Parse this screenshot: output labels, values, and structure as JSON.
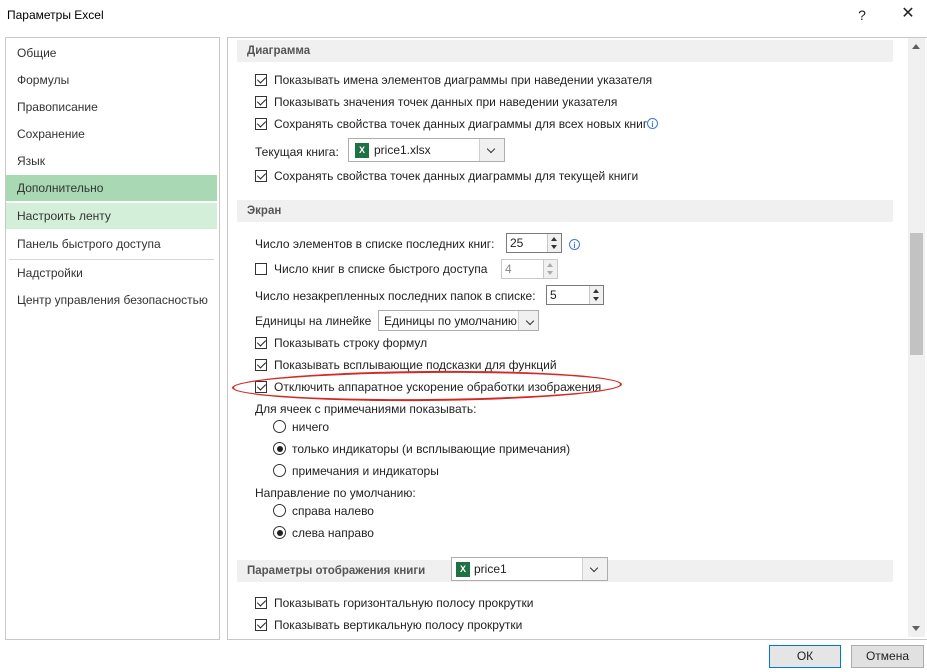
{
  "window": {
    "title": "Параметры Excel",
    "help_label": "?",
    "close_label": "✕"
  },
  "sidebar": {
    "items": [
      {
        "label": "Общие"
      },
      {
        "label": "Формулы"
      },
      {
        "label": "Правописание"
      },
      {
        "label": "Сохранение"
      },
      {
        "label": "Язык"
      },
      {
        "label": "Дополнительно"
      },
      {
        "label": "Настроить ленту"
      },
      {
        "label": "Панель быстрого доступа"
      },
      {
        "label": "Надстройки"
      },
      {
        "label": "Центр управления безопасностью"
      }
    ],
    "active_item": "Дополнительно"
  },
  "chart_section": {
    "header": "Диаграмма",
    "options": [
      {
        "label": "Показывать имена элементов диаграммы при наведении указателя",
        "checked": true
      },
      {
        "label": "Показывать значения точек данных при наведении указателя",
        "checked": true
      },
      {
        "label": "Сохранять свойства точек данных диаграммы для всех новых книг",
        "checked": true
      }
    ],
    "current_book_label": "Текущая книга:",
    "current_book_value": "price1.xlsx",
    "current_book_option": {
      "label": "Сохранять свойства точек данных диаграммы для текущей книги",
      "checked": true
    }
  },
  "screen_section": {
    "header": "Экран",
    "recent_count_label": "Число элементов в списке последних книг:",
    "recent_count_value": "25",
    "quick_access_label": "Число книг в списке быстрого доступа",
    "quick_access_checked": false,
    "quick_access_value": "4",
    "unpinned_folders_label": "Число незакрепленных последних папок в списке:",
    "unpinned_folders_value": "5",
    "ruler_units_label": "Единицы на линейке",
    "ruler_units_value": "Единицы по умолчанию",
    "show_formula_bar": {
      "label": "Показывать строку формул",
      "checked": true
    },
    "show_function_tips": {
      "label": "Показывать всплывающие подсказки для функций",
      "checked": true
    },
    "disable_hw_accel": {
      "label": "Отключить аппаратное ускорение обработки изображения",
      "checked": true
    },
    "comments_label": "Для ячеек с примечаниями показывать:",
    "comments_options": [
      {
        "label": "ничего",
        "checked": false
      },
      {
        "label": "только индикаторы (и всплывающие примечания)",
        "checked": true
      },
      {
        "label": "примечания и индикаторы",
        "checked": false
      }
    ],
    "direction_label": "Направление по умолчанию:",
    "direction_options": [
      {
        "label": "справа налево",
        "checked": false
      },
      {
        "label": "слева направо",
        "checked": true
      }
    ]
  },
  "book_display_section": {
    "header": "Параметры отображения книги",
    "book_value": "price1",
    "options": [
      {
        "label": "Показывать горизонтальную полосу прокрутки",
        "checked": true
      },
      {
        "label": "Показывать вертикальную полосу прокрутки",
        "checked": true
      }
    ]
  },
  "footer": {
    "ok_label": "ОК",
    "cancel_label": "Отмена"
  },
  "colors": {
    "active_nav": "#a9d9b3",
    "hover_nav": "#d4efd9",
    "highlight_outline": "#d42a24",
    "primary_border": "#0078d7"
  }
}
